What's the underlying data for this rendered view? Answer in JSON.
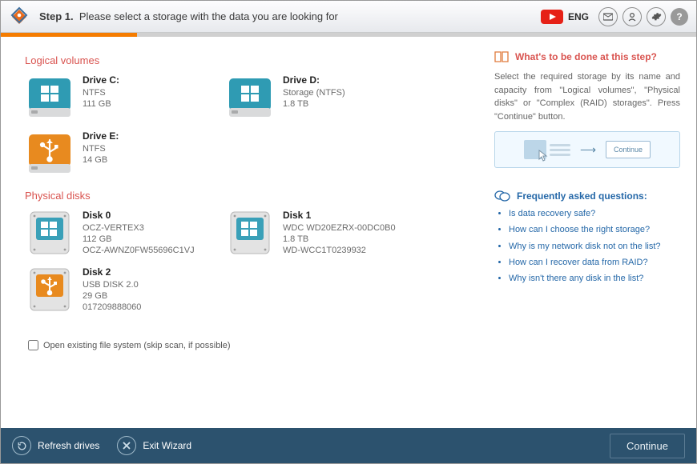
{
  "header": {
    "step_label": "Step 1.",
    "step_text": "Please select a storage with the data you are looking for",
    "language": "ENG"
  },
  "sections": {
    "logical_title": "Logical volumes",
    "physical_title": "Physical disks"
  },
  "logical": [
    {
      "name": "Drive C:",
      "fs": "NTFS",
      "size": "111 GB",
      "icon": "win-teal"
    },
    {
      "name": "Drive D:",
      "fs": "Storage (NTFS)",
      "size": "1.8 TB",
      "icon": "win-teal"
    },
    {
      "name": "Drive E:",
      "fs": "NTFS",
      "size": "14 GB",
      "icon": "usb-orange"
    }
  ],
  "physical": [
    {
      "name": "Disk 0",
      "model": "OCZ-VERTEX3",
      "size": "112 GB",
      "serial": "OCZ-AWNZ0FW55696C1VJ",
      "icon": "hdd-win"
    },
    {
      "name": "Disk 1",
      "model": "WDC WD20EZRX-00DC0B0",
      "size": "1.8 TB",
      "serial": "WD-WCC1T0239932",
      "icon": "hdd-win"
    },
    {
      "name": "Disk 2",
      "model": "USB DISK 2.0",
      "size": "29 GB",
      "serial": "017209888060",
      "icon": "hdd-usb"
    }
  ],
  "checkbox": {
    "label": "Open existing file system (skip scan, if possible)"
  },
  "side": {
    "whats_title": "What's to be done at this step?",
    "whats_text": "Select the required storage by its name and capacity from \"Logical volumes\", \"Physical disks\" or \"Complex (RAID) storages\". Press \"Continue\" button.",
    "hint_button": "Continue",
    "faq_title": "Frequently asked questions:",
    "faq": [
      "Is data recovery safe?",
      "How can I choose the right storage?",
      "Why is my network disk not on the list?",
      "How can I recover data from RAID?",
      "Why isn't there any disk in the list?"
    ]
  },
  "footer": {
    "refresh": "Refresh drives",
    "exit": "Exit Wizard",
    "continue": "Continue"
  }
}
